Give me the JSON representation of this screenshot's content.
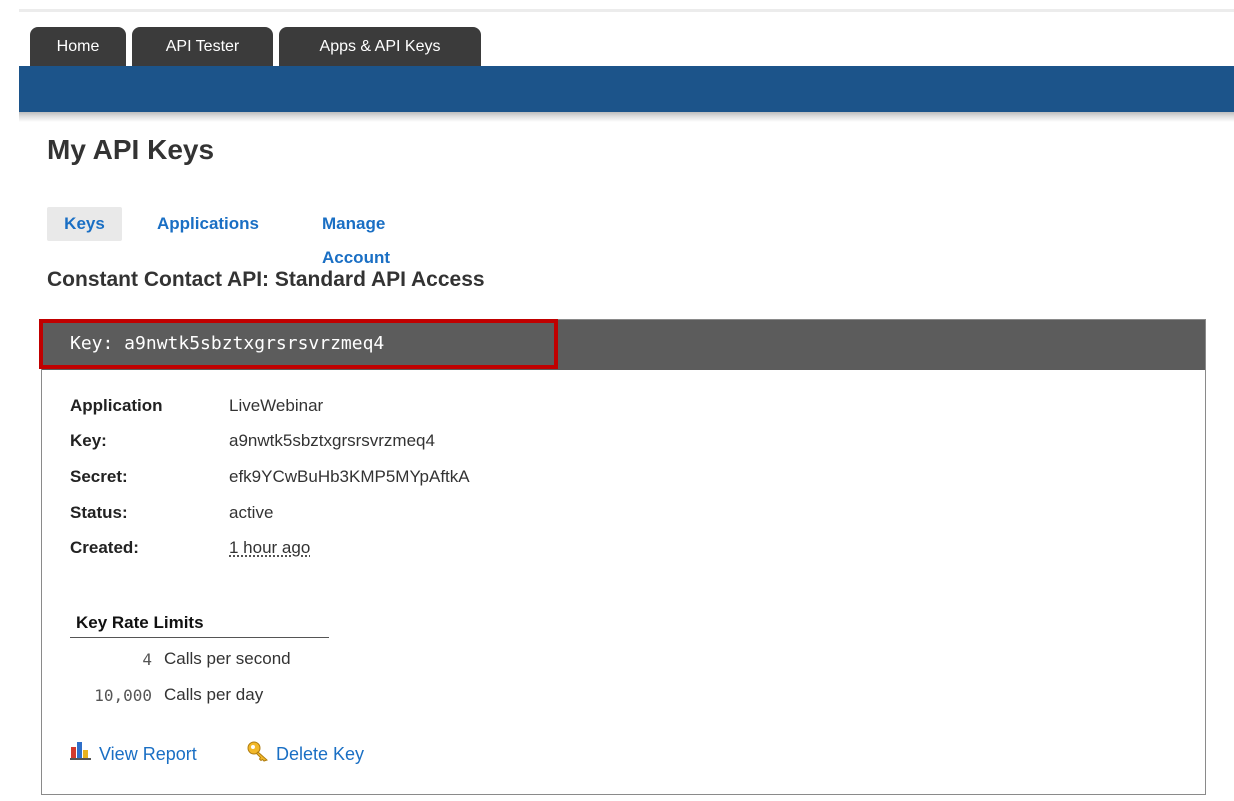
{
  "tabs": [
    {
      "label": "Home"
    },
    {
      "label": "API Tester"
    },
    {
      "label": "Apps & API Keys"
    }
  ],
  "page": {
    "title": "My API Keys",
    "section_title": "Constant Contact API: Standard API Access"
  },
  "subnav": [
    {
      "label": "Keys",
      "active": true
    },
    {
      "label": "Applications",
      "active": false
    },
    {
      "label": "Manage Account",
      "active": false
    }
  ],
  "key_panel": {
    "header": "Key: a9nwtk5sbztxgrsrsvrzmeq4",
    "fields": [
      {
        "label": "Application",
        "value": "LiveWebinar"
      },
      {
        "label": "Key:",
        "value": "a9nwtk5sbztxgrsrsvrzmeq4"
      },
      {
        "label": "Secret:",
        "value": "efk9YCwBuHb3KMP5MYpAftkA"
      },
      {
        "label": "Status:",
        "value": "active"
      },
      {
        "label": "Created:",
        "value": "1 hour ago"
      }
    ],
    "rate_limits": {
      "title": "Key Rate Limits",
      "rows": [
        {
          "value": "4",
          "unit": "Calls per second"
        },
        {
          "value": "10,000",
          "unit": "Calls per day"
        }
      ]
    },
    "actions": {
      "view_report": "View Report",
      "delete_key": "Delete Key"
    }
  },
  "colors": {
    "nav_bar": "#1c548a",
    "tab": "#3b3b3b",
    "link": "#1a6fc4",
    "panel_header": "#5c5c5c",
    "highlight": "#c00000"
  },
  "icons": {
    "view_report": "bar-chart-icon",
    "delete_key": "key-icon"
  }
}
